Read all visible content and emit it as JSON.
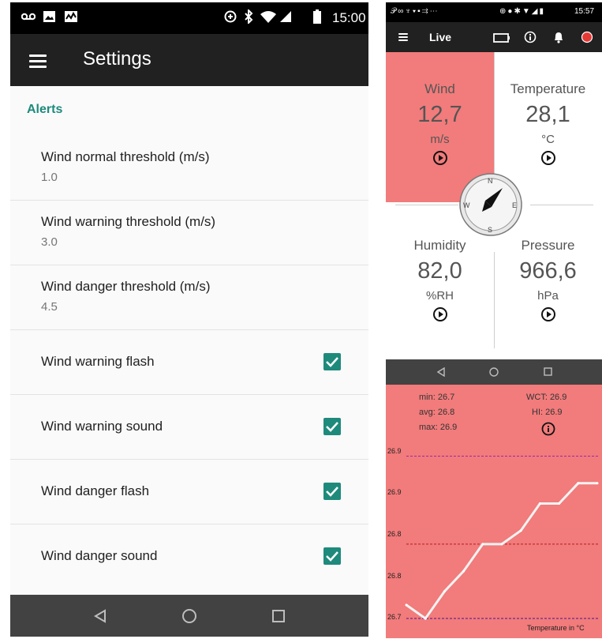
{
  "left": {
    "status": {
      "time": "15:00"
    },
    "appbar": {
      "title": "Settings"
    },
    "section_header": "Alerts",
    "items": [
      {
        "title": "Wind normal threshold (m/s)",
        "summary": "1.0"
      },
      {
        "title": "Wind warning threshold (m/s)",
        "summary": "3.0"
      },
      {
        "title": "Wind danger threshold (m/s)",
        "summary": "4.5"
      },
      {
        "title": "Wind warning flash",
        "checked": true
      },
      {
        "title": "Wind warning sound",
        "checked": true
      },
      {
        "title": "Wind danger flash",
        "checked": true
      },
      {
        "title": "Wind danger sound",
        "checked": true
      }
    ],
    "colors": {
      "accent": "#1e8a7c",
      "appbar": "#212121"
    }
  },
  "live": {
    "status": {
      "time": "15:57"
    },
    "appbar": {
      "title": "Live"
    },
    "tiles": {
      "wind": {
        "label": "Wind",
        "value": "12,7",
        "unit": "m/s"
      },
      "temperature": {
        "label": "Temperature",
        "value": "28,1",
        "unit": "°C"
      },
      "humidity": {
        "label": "Humidity",
        "value": "82,0",
        "unit": "%RH"
      },
      "pressure": {
        "label": "Pressure",
        "value": "966,6",
        "unit": "hPa"
      }
    },
    "compass": {
      "n": "N",
      "s": "S",
      "e": "E",
      "w": "W"
    },
    "colors": {
      "wind_tile": "#f27b7b",
      "record": "#e53935"
    }
  },
  "chart_panel": {
    "stats": {
      "min": "min: 26.7",
      "avg": "avg: 26.8",
      "max": "max: 26.9",
      "wct": "WCT: 26.9",
      "hi": "HI: 26.9"
    },
    "caption": "Temperature in °C"
  },
  "chart_data": {
    "type": "line",
    "title": "",
    "xlabel": "",
    "ylabel": "Temperature in °C",
    "ylim": [
      26.7,
      26.95
    ],
    "y_tick_labels": [
      "26.9",
      "26.9",
      "26.8",
      "26.8",
      "26.7"
    ],
    "reference_lines": [
      {
        "name": "max",
        "value": 26.94,
        "color": "#9c27b0"
      },
      {
        "name": "avg",
        "value": 26.81,
        "color": "#b71c1c"
      },
      {
        "name": "min",
        "value": 26.7,
        "color": "#4a148c"
      }
    ],
    "series": [
      {
        "values": [
          26.72,
          26.7,
          26.74,
          26.77,
          26.81,
          26.81,
          26.83,
          26.87,
          26.87,
          26.9,
          26.9
        ]
      }
    ]
  }
}
